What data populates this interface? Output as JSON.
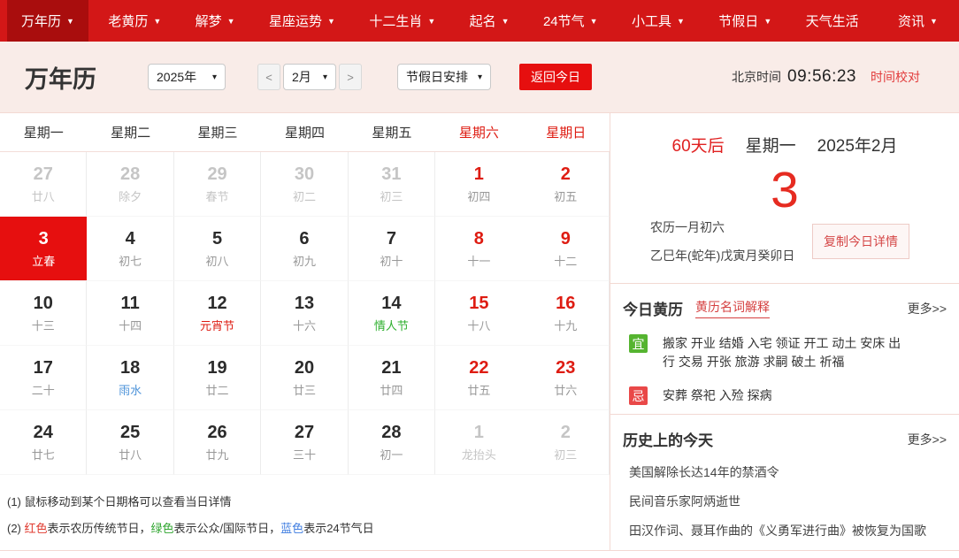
{
  "colors": {
    "nav_bg": "#d31717",
    "nav_active_bg": "#a90d0d",
    "header_bg": "#f9ece8",
    "divider_pink": "#f3d9d3",
    "accent_red": "#e60f0f",
    "weekend_red": "#de1c12",
    "dim_gray": "#c5c5c5",
    "lunar_gray": "#999999",
    "fest_green": "#2eaf2e",
    "term_blue": "#4d93d9",
    "yi_green": "#55b430",
    "ji_red": "#e94848",
    "link_red": "#d54040"
  },
  "nav": {
    "items": [
      {
        "label": "万年历",
        "arrow": "▼",
        "cls": "active"
      },
      {
        "label": "老黄历",
        "arrow": "▼",
        "cls": ""
      },
      {
        "label": "解梦",
        "arrow": "▼",
        "cls": ""
      },
      {
        "label": "星座运势",
        "arrow": "▼",
        "cls": ""
      },
      {
        "label": "十二生肖",
        "arrow": "▼",
        "cls": ""
      },
      {
        "label": "起名",
        "arrow": "▼",
        "cls": ""
      },
      {
        "label": "24节气",
        "arrow": "▼",
        "cls": ""
      },
      {
        "label": "小工具",
        "arrow": "▼",
        "cls": ""
      },
      {
        "label": "节假日",
        "arrow": "▼",
        "cls": ""
      },
      {
        "label": "天气生活",
        "arrow": "",
        "cls": ""
      },
      {
        "label": "资讯",
        "arrow": "▼",
        "cls": ""
      }
    ]
  },
  "header": {
    "title": "万年历",
    "year_select": "2025年",
    "prev_button": "<",
    "month_select": "2月",
    "next_button": ">",
    "holiday_select": "节假日安排",
    "today_button": "返回今日",
    "time_label": "北京时间",
    "time_value": "09:56:23",
    "time_check": "时间校对",
    "select_caret": "▾"
  },
  "calendar": {
    "weekdays": [
      {
        "label": "星期一",
        "cls": ""
      },
      {
        "label": "星期二",
        "cls": ""
      },
      {
        "label": "星期三",
        "cls": ""
      },
      {
        "label": "星期四",
        "cls": ""
      },
      {
        "label": "星期五",
        "cls": ""
      },
      {
        "label": "星期六",
        "cls": "weekend"
      },
      {
        "label": "星期日",
        "cls": "weekend"
      }
    ],
    "cells": [
      {
        "day": "27",
        "lunar": "廿八",
        "cls": "dim"
      },
      {
        "day": "28",
        "lunar": "除夕",
        "cls": "dim"
      },
      {
        "day": "29",
        "lunar": "春节",
        "cls": "dim"
      },
      {
        "day": "30",
        "lunar": "初二",
        "cls": "dim"
      },
      {
        "day": "31",
        "lunar": "初三",
        "cls": "dim"
      },
      {
        "day": "1",
        "lunar": "初四",
        "cls": "weekend"
      },
      {
        "day": "2",
        "lunar": "初五",
        "cls": "weekend"
      },
      {
        "day": "3",
        "lunar": "立春",
        "cls": "today"
      },
      {
        "day": "4",
        "lunar": "初七",
        "cls": ""
      },
      {
        "day": "5",
        "lunar": "初八",
        "cls": ""
      },
      {
        "day": "6",
        "lunar": "初九",
        "cls": ""
      },
      {
        "day": "7",
        "lunar": "初十",
        "cls": ""
      },
      {
        "day": "8",
        "lunar": "十一",
        "cls": "weekend"
      },
      {
        "day": "9",
        "lunar": "十二",
        "cls": "weekend"
      },
      {
        "day": "10",
        "lunar": "十三",
        "cls": ""
      },
      {
        "day": "11",
        "lunar": "十四",
        "cls": ""
      },
      {
        "day": "12",
        "lunar": "元宵节",
        "cls": "fest-red"
      },
      {
        "day": "13",
        "lunar": "十六",
        "cls": ""
      },
      {
        "day": "14",
        "lunar": "情人节",
        "cls": "fest-green"
      },
      {
        "day": "15",
        "lunar": "十八",
        "cls": "weekend"
      },
      {
        "day": "16",
        "lunar": "十九",
        "cls": "weekend"
      },
      {
        "day": "17",
        "lunar": "二十",
        "cls": ""
      },
      {
        "day": "18",
        "lunar": "雨水",
        "cls": "fest-blue"
      },
      {
        "day": "19",
        "lunar": "廿二",
        "cls": ""
      },
      {
        "day": "20",
        "lunar": "廿三",
        "cls": ""
      },
      {
        "day": "21",
        "lunar": "廿四",
        "cls": ""
      },
      {
        "day": "22",
        "lunar": "廿五",
        "cls": "weekend"
      },
      {
        "day": "23",
        "lunar": "廿六",
        "cls": "weekend"
      },
      {
        "day": "24",
        "lunar": "廿七",
        "cls": ""
      },
      {
        "day": "25",
        "lunar": "廿八",
        "cls": ""
      },
      {
        "day": "26",
        "lunar": "廿九",
        "cls": ""
      },
      {
        "day": "27",
        "lunar": "三十",
        "cls": ""
      },
      {
        "day": "28",
        "lunar": "初一",
        "cls": ""
      },
      {
        "day": "1",
        "lunar": "龙抬头",
        "cls": "dim"
      },
      {
        "day": "2",
        "lunar": "初三",
        "cls": "dim"
      }
    ]
  },
  "notes": {
    "note1": "(1) 鼠标移动到某个日期格可以查看当日详情",
    "note2_prefix": "(2) ",
    "note2_red": "红色",
    "note2_seg1": "表示农历传统节日，",
    "note2_green": "绿色",
    "note2_seg2": "表示公众/国际节日，",
    "note2_blue": "蓝色",
    "note2_seg3": "表示24节气日"
  },
  "today_panel": {
    "days_after": "60天后",
    "weekday": "星期一",
    "month_label": "2025年2月",
    "big_day": "3",
    "lunar_line": "农历一月初六",
    "ganzhi_line": "乙巳年(蛇年)戊寅月癸卯日",
    "copy_button": "复制今日详情"
  },
  "huangli": {
    "title": "今日黄历",
    "glossary_link": "黄历名词解释",
    "more_link": "更多>>",
    "yi_badge": "宜",
    "yi_text": "搬家 开业 结婚 入宅 领证 开工 动土 安床 出行 交易 开张 旅游 求嗣 破土 祈福",
    "ji_badge": "忌",
    "ji_text": "安葬 祭祀 入殓 探病"
  },
  "history": {
    "title": "历史上的今天",
    "more_link": "更多>>",
    "items": [
      "美国解除长达14年的禁酒令",
      "民间音乐家阿炳逝世",
      "田汉作词、聂耳作曲的《义勇军进行曲》被恢复为国歌"
    ]
  }
}
